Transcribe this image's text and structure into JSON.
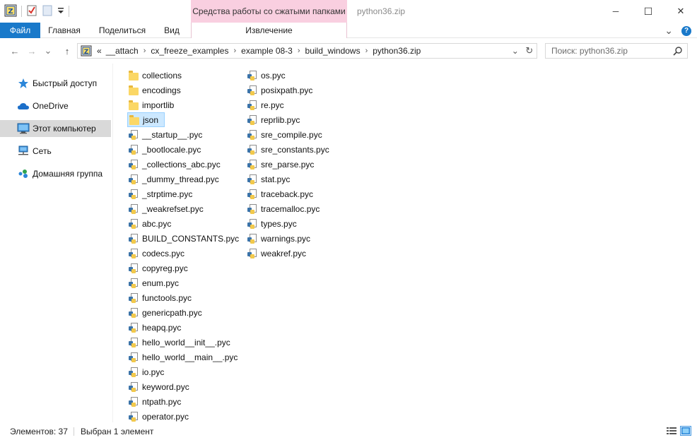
{
  "window": {
    "title": "python36.zip",
    "context_group": "Средства работы со сжатыми папками",
    "minimize": "─",
    "maximize": "☐",
    "close": "✕"
  },
  "ribbon": {
    "tabs": [
      {
        "label": "Файл"
      },
      {
        "label": "Главная"
      },
      {
        "label": "Поделиться"
      },
      {
        "label": "Вид"
      }
    ],
    "context_tab": "Извлечение",
    "collapse_chevron": "⌄",
    "help": "?"
  },
  "address": {
    "back": "←",
    "forward": "→",
    "recent": "⌄",
    "up": "↑",
    "overflow": "«",
    "crumbs": [
      "__attach",
      "cx_freeze_examples",
      "example 08-3",
      "build_windows",
      "python36.zip"
    ],
    "separator": "›",
    "dropdown": "⌄",
    "refresh": "↻"
  },
  "search": {
    "placeholder": "Поиск: python36.zip"
  },
  "nav": [
    {
      "label": "Быстрый доступ",
      "icon": "star-icon"
    },
    {
      "label": "OneDrive",
      "icon": "cloud-icon"
    },
    {
      "label": "Этот компьютер",
      "icon": "computer-icon",
      "selected": true
    },
    {
      "label": "Сеть",
      "icon": "network-icon"
    },
    {
      "label": "Домашняя группа",
      "icon": "homegroup-icon"
    }
  ],
  "files_col1": [
    {
      "name": "collections",
      "type": "folder"
    },
    {
      "name": "encodings",
      "type": "folder"
    },
    {
      "name": "importlib",
      "type": "folder"
    },
    {
      "name": "json",
      "type": "folder",
      "selected": true
    },
    {
      "name": "__startup__.pyc",
      "type": "pyc"
    },
    {
      "name": "_bootlocale.pyc",
      "type": "pyc"
    },
    {
      "name": "_collections_abc.pyc",
      "type": "pyc"
    },
    {
      "name": "_dummy_thread.pyc",
      "type": "pyc"
    },
    {
      "name": "_strptime.pyc",
      "type": "pyc"
    },
    {
      "name": "_weakrefset.pyc",
      "type": "pyc"
    },
    {
      "name": "abc.pyc",
      "type": "pyc"
    },
    {
      "name": "BUILD_CONSTANTS.pyc",
      "type": "pyc"
    },
    {
      "name": "codecs.pyc",
      "type": "pyc"
    },
    {
      "name": "copyreg.pyc",
      "type": "pyc"
    },
    {
      "name": "enum.pyc",
      "type": "pyc"
    },
    {
      "name": "functools.pyc",
      "type": "pyc"
    },
    {
      "name": "genericpath.pyc",
      "type": "pyc"
    },
    {
      "name": "heapq.pyc",
      "type": "pyc"
    },
    {
      "name": "hello_world__init__.pyc",
      "type": "pyc"
    },
    {
      "name": "hello_world__main__.pyc",
      "type": "pyc"
    },
    {
      "name": "io.pyc",
      "type": "pyc"
    },
    {
      "name": "keyword.pyc",
      "type": "pyc"
    },
    {
      "name": "ntpath.pyc",
      "type": "pyc"
    },
    {
      "name": "operator.pyc",
      "type": "pyc"
    }
  ],
  "files_col2": [
    {
      "name": "os.pyc",
      "type": "pyc"
    },
    {
      "name": "posixpath.pyc",
      "type": "pyc"
    },
    {
      "name": "re.pyc",
      "type": "pyc"
    },
    {
      "name": "reprlib.pyc",
      "type": "pyc"
    },
    {
      "name": "sre_compile.pyc",
      "type": "pyc"
    },
    {
      "name": "sre_constants.pyc",
      "type": "pyc"
    },
    {
      "name": "sre_parse.pyc",
      "type": "pyc"
    },
    {
      "name": "stat.pyc",
      "type": "pyc"
    },
    {
      "name": "traceback.pyc",
      "type": "pyc"
    },
    {
      "name": "tracemalloc.pyc",
      "type": "pyc"
    },
    {
      "name": "types.pyc",
      "type": "pyc"
    },
    {
      "name": "warnings.pyc",
      "type": "pyc"
    },
    {
      "name": "weakref.pyc",
      "type": "pyc"
    }
  ],
  "status": {
    "count": "Элементов: 37",
    "selection": "Выбран 1 элемент"
  },
  "colors": {
    "accent": "#1979ca",
    "context_group_bg": "#f9cfe0",
    "selection_bg": "#cce8ff",
    "selection_border": "#99d1ff",
    "nav_selected_bg": "#d9d9d9"
  }
}
